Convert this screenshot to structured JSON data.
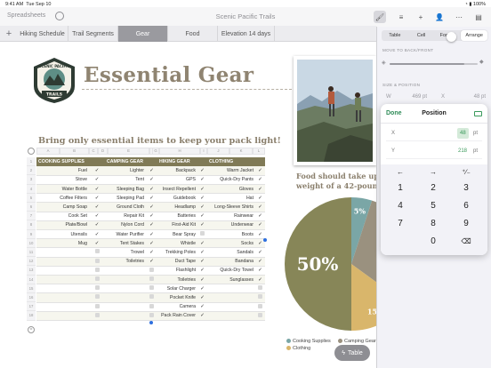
{
  "status": {
    "time": "9:41 AM",
    "date": "Tue Sep 10",
    "battery": "100%"
  },
  "toolbar": {
    "back_label": "Spreadsheets",
    "document_title": "Scenic Pacific Trails",
    "icons": [
      "undo-icon",
      "paintbrush-icon",
      "align-icon",
      "add-icon",
      "collaborate-icon",
      "more-icon",
      "pages-icon"
    ]
  },
  "tabs": [
    {
      "label": "Hiking Schedule",
      "active": false
    },
    {
      "label": "Trail Segments",
      "active": false
    },
    {
      "label": "Gear",
      "active": true
    },
    {
      "label": "Food",
      "active": false
    },
    {
      "label": "Elevation 14 days",
      "active": false
    }
  ],
  "canvas": {
    "title": "Essential Gear",
    "logo_text_top": "SCENIC PACIFIC",
    "logo_text_bottom": "TRAILS",
    "subtitle": "Bring only essential items to keep your pack light!",
    "food_text_line1": "Food should take up",
    "food_text_line2": "weight of a 42-pound",
    "table_button": "Table"
  },
  "table": {
    "column_letters": [
      "A",
      "B",
      "C",
      "D",
      "E",
      "F",
      "G",
      "H",
      "I",
      "J",
      "K",
      "L"
    ],
    "headers": [
      "COOKING SUPPLIES",
      "CAMPING GEAR",
      "HIKING GEAR",
      "CLOTHING"
    ],
    "rows": [
      [
        "Fuel",
        "✓",
        "Lighter",
        "✓",
        "Backpack",
        "✓",
        "Warm Jacket",
        "✓"
      ],
      [
        "Stove",
        "✓",
        "Tent",
        "✓",
        "GPS",
        "✓",
        "Quick-Dry Pants",
        "✓"
      ],
      [
        "Water Bottle",
        "✓",
        "Sleeping Bag",
        "✓",
        "Insect Repellent",
        "✓",
        "Gloves",
        "✓"
      ],
      [
        "Coffee Filters",
        "✓",
        "Sleeping Pad",
        "✓",
        "Guidebook",
        "✓",
        "Hat",
        "✓"
      ],
      [
        "Camp Soap",
        "✓",
        "Ground Cloth",
        "✓",
        "Headlamp",
        "✓",
        "Long-Sleeve Shirts",
        "✓"
      ],
      [
        "Cook Set",
        "✓",
        "Repair Kit",
        "✓",
        "Batteries",
        "✓",
        "Rainwear",
        "✓"
      ],
      [
        "Plate/Bowl",
        "✓",
        "Nylon Cord",
        "✓",
        "First-Aid Kit",
        "✓",
        "Underwear",
        "✓"
      ],
      [
        "Utensils",
        "✓",
        "Water Purifier",
        "✓",
        "Bear Spray",
        "☐",
        "Boots",
        "✓"
      ],
      [
        "Mug",
        "✓",
        "Tent Stakes",
        "✓",
        "Whistle",
        "✓",
        "Socks",
        "✓"
      ],
      [
        "",
        "☐",
        "Trowel",
        "✓",
        "Trekking Poles",
        "✓",
        "Sandals",
        "✓"
      ],
      [
        "",
        "☐",
        "Toiletries",
        "✓",
        "Duct Tape",
        "✓",
        "Bandana",
        "✓"
      ],
      [
        "",
        "☐",
        "",
        "☐",
        "Flashlight",
        "✓",
        "Quick-Dry Towel",
        "✓"
      ],
      [
        "",
        "☐",
        "",
        "☐",
        "Toiletries",
        "✓",
        "Sunglasses",
        "✓"
      ],
      [
        "",
        "☐",
        "",
        "☐",
        "Solar Charger",
        "✓",
        "",
        "☐"
      ],
      [
        "",
        "☐",
        "",
        "☐",
        "Pocket Knife",
        "✓",
        "",
        "☐"
      ],
      [
        "",
        "☐",
        "",
        "☐",
        "Camera",
        "✓",
        "",
        "☐"
      ],
      [
        "",
        "☐",
        "",
        "☐",
        "Pack Rain Cover",
        "✓",
        "",
        "☐"
      ]
    ]
  },
  "chart_data": {
    "type": "pie",
    "slices": [
      {
        "name": "Food",
        "value": 50,
        "label": "50%",
        "color": "#878658"
      },
      {
        "name": "Cooking Supplies",
        "value": 5,
        "label": "5%",
        "color": "#7aa6a6"
      },
      {
        "name": "Camping Gear",
        "value": 30,
        "label": "",
        "color": "#9a917f"
      },
      {
        "name": "Clothing",
        "value": 15,
        "label": "15%",
        "color": "#d9b66b"
      }
    ],
    "legend": [
      "Cooking Supplies",
      "Camping Gear",
      "Clothing"
    ]
  },
  "inspector": {
    "tabs": [
      {
        "label": "Table",
        "active": false
      },
      {
        "label": "Cell",
        "active": false
      },
      {
        "label": "Format",
        "active": false
      },
      {
        "label": "Arrange",
        "active": true
      }
    ],
    "move_section": "MOVE TO BACK/FRONT",
    "size_section": "SIZE & POSITION",
    "move_level": 0.85,
    "w_label": "W",
    "w_value": "469 pt",
    "x_label_top": "X",
    "x_value_top": "48 pt"
  },
  "popover": {
    "done": "Done",
    "title": "Position",
    "x_label": "X",
    "x_value": "48",
    "x_unit": "pt",
    "y_label": "Y",
    "y_value": "218",
    "y_unit": "pt",
    "keys": [
      "←",
      "→",
      "⁺∕₋",
      "1",
      "2",
      "3",
      "4",
      "5",
      "6",
      "7",
      "8",
      "9",
      "0"
    ]
  }
}
